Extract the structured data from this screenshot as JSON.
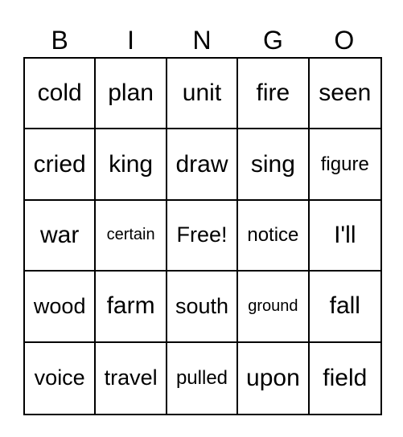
{
  "header": [
    "B",
    "I",
    "N",
    "G",
    "O"
  ],
  "cells": [
    [
      "cold",
      "plan",
      "unit",
      "fire",
      "seen"
    ],
    [
      "cried",
      "king",
      "draw",
      "sing",
      "figure"
    ],
    [
      "war",
      "certain",
      "Free!",
      "notice",
      "I'll"
    ],
    [
      "wood",
      "farm",
      "south",
      "ground",
      "fall"
    ],
    [
      "voice",
      "travel",
      "pulled",
      "upon",
      "field"
    ]
  ]
}
